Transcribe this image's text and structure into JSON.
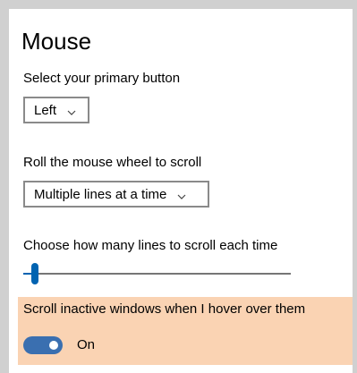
{
  "page": {
    "title": "Mouse"
  },
  "primary_button": {
    "label": "Select your primary button",
    "selected": "Left"
  },
  "scroll_wheel": {
    "label": "Roll the mouse wheel to scroll",
    "selected": "Multiple lines at a time"
  },
  "scroll_lines": {
    "label": "Choose how many lines to scroll each time",
    "slider_fraction": 0.03
  },
  "inactive_scroll": {
    "label": "Scroll inactive windows when I hover over them",
    "toggle_on": true,
    "state_text": "On"
  },
  "colors": {
    "accent": "#0063b1",
    "toggle_on": "#3a6fb0",
    "highlight": "#fad3b3"
  },
  "icons": {
    "dropdown": "chevron-down-icon"
  }
}
